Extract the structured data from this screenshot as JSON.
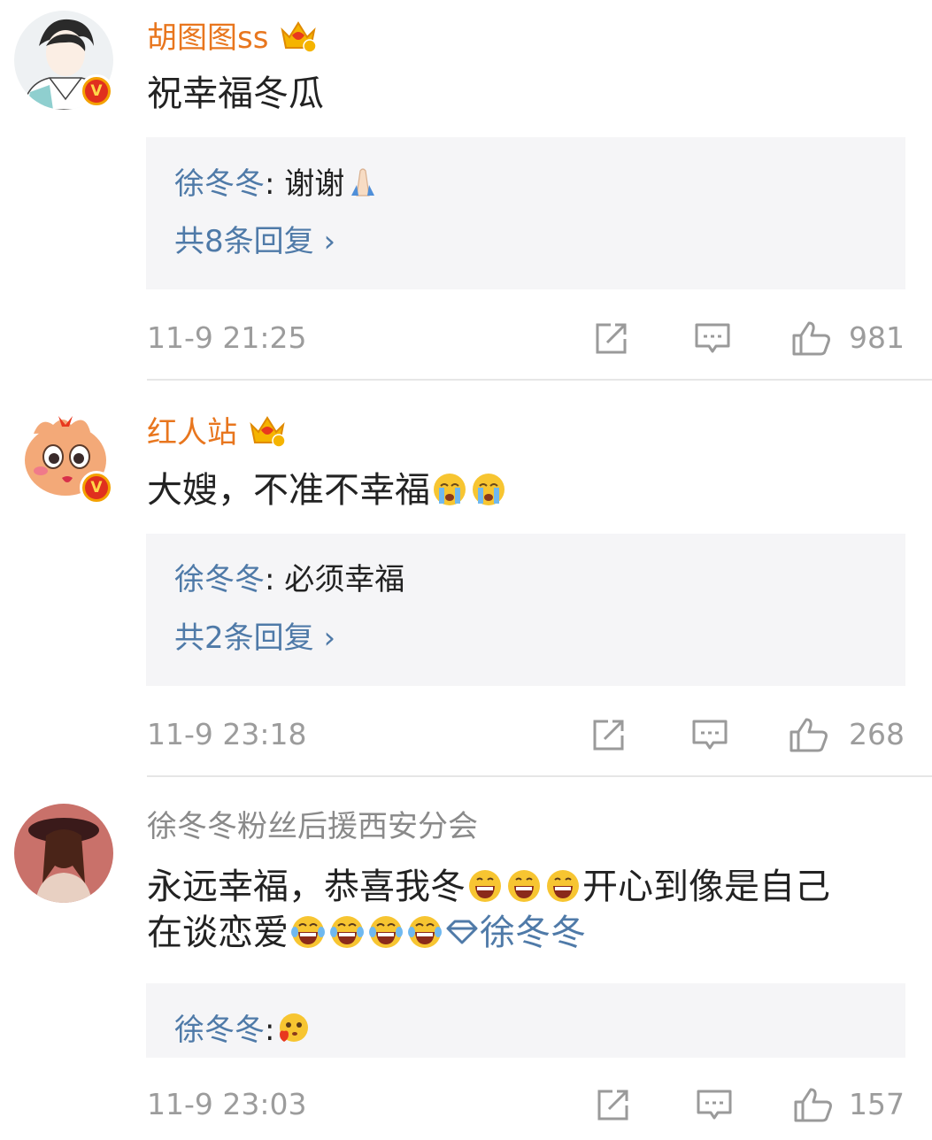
{
  "comments": [
    {
      "username": "胡图图ss",
      "content": "祝幸福冬瓜",
      "reply": {
        "name": "徐冬冬",
        "text": ": 谢谢"
      },
      "more_replies": "共8条回复 ›",
      "time": "11-9 21:25",
      "likes": "981"
    },
    {
      "username": "红人站",
      "content": "大嫂，不准不幸福",
      "reply": {
        "name": "徐冬冬",
        "text": ": 必须幸福"
      },
      "more_replies": "共2条回复 ›",
      "time": "11-9 23:18",
      "likes": "268"
    },
    {
      "username": "徐冬冬粉丝后援西安分会",
      "content_part1": "永远幸福，恭喜我冬",
      "content_part2": "开心到像是自己",
      "content_part3": "在谈恋爱",
      "mention": "徐冬冬",
      "reply": {
        "name": "徐冬冬",
        "text": ":"
      },
      "time": "11-9 23:03",
      "likes": "157"
    }
  ],
  "icons": [
    "repost-icon",
    "comment-icon",
    "like-icon",
    "crown-icon",
    "verified-v-icon"
  ],
  "colors": {
    "username_vip": "#e8761e",
    "username_normal": "#8a8a8a",
    "link": "#4f7aa8",
    "reply_bg": "#f5f5f7",
    "meta": "#9c9c9c"
  }
}
